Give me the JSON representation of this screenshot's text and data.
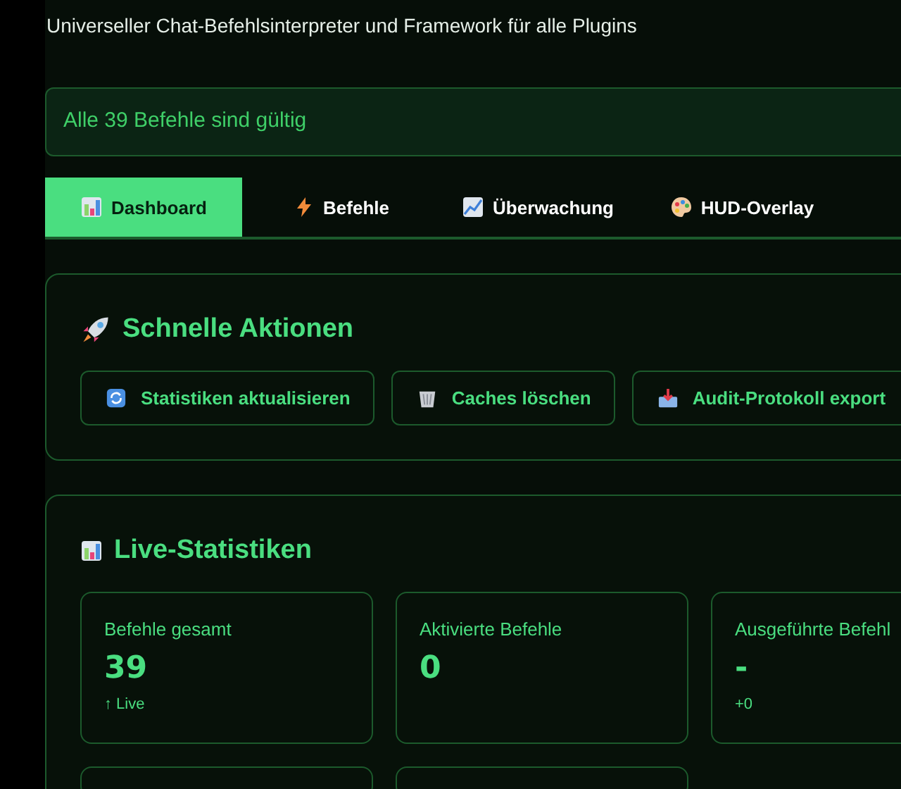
{
  "subtitle": "Universeller Chat-Befehlsinterpreter und Framework für alle Plugins",
  "status_banner": "Alle 39 Befehle sind gültig",
  "tabs": [
    {
      "label": "Dashboard",
      "selected": true
    },
    {
      "label": "Befehle",
      "selected": false
    },
    {
      "label": "Überwachung",
      "selected": false
    },
    {
      "label": "HUD-Overlay",
      "selected": false
    }
  ],
  "quick_actions": {
    "title": "Schnelle Aktionen",
    "buttons": [
      {
        "label": "Statistiken aktualisieren"
      },
      {
        "label": "Caches löschen"
      },
      {
        "label": "Audit-Protokoll export"
      }
    ]
  },
  "live_stats": {
    "title": "Live-Statistiken",
    "cards": [
      {
        "label": "Befehle gesamt",
        "value": "39",
        "note": "↑ Live"
      },
      {
        "label": "Aktivierte Befehle",
        "value": "0"
      },
      {
        "label": "Ausgeführte Befehl",
        "value": "-",
        "note": "+0"
      }
    ]
  }
}
